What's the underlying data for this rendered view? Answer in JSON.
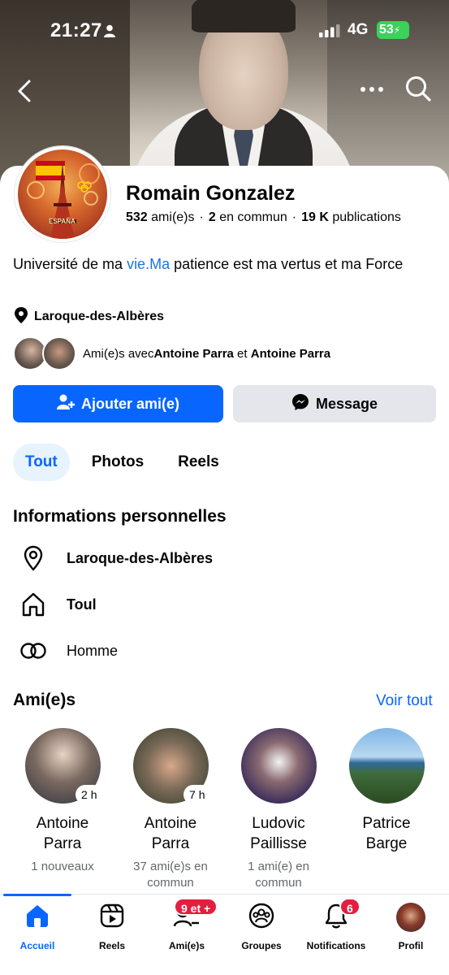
{
  "status_bar": {
    "time": "21:27",
    "network": "4G",
    "battery": "53"
  },
  "profile": {
    "name": "Romain Gonzalez",
    "stats": {
      "friends_count": "532",
      "friends_label": "ami(e)s",
      "mutual_count": "2",
      "mutual_label": "en commun",
      "posts_count": "19 K",
      "posts_label": "publications"
    },
    "bio": {
      "prefix": "Université de ma ",
      "link": "vie.Ma",
      "suffix": " patience est ma vertus et ma Force"
    },
    "location": "Laroque-des-Albères",
    "mutual": {
      "prefix": "Ami(e)s avec ",
      "name1": "Antoine Parra",
      "joiner": " et ",
      "name2": "Antoine Parra"
    },
    "avatar_text": "ESPAÑA"
  },
  "actions": {
    "add_friend": "Ajouter ami(e)",
    "message": "Message"
  },
  "tabs": [
    {
      "label": "Tout",
      "active": true
    },
    {
      "label": "Photos"
    },
    {
      "label": "Reels"
    }
  ],
  "personal_info": {
    "title": "Informations personnelles",
    "items": [
      {
        "icon": "location-pin-icon",
        "text": "Laroque-des-Albères"
      },
      {
        "icon": "home-icon",
        "text": "Toul"
      },
      {
        "icon": "gender-icon",
        "text": "Homme"
      }
    ]
  },
  "friends_section": {
    "title": "Ami(e)s",
    "see_all": "Voir tout",
    "friends": [
      {
        "first": "Antoine",
        "last": "Parra",
        "sub": "1 nouveaux",
        "badge": "2 h"
      },
      {
        "first": "Antoine",
        "last": "Parra",
        "sub": "37 ami(e)s en commun",
        "badge": "7 h"
      },
      {
        "first": "Ludovic",
        "last": "Paillisse",
        "sub": "1 ami(e) en commun"
      },
      {
        "first": "Patrice",
        "last": "Barge",
        "sub": ""
      }
    ]
  },
  "bottom_nav": [
    {
      "label": "Accueil",
      "icon": "home-icon",
      "active": true
    },
    {
      "label": "Reels",
      "icon": "reels-icon"
    },
    {
      "label": "Ami(e)s",
      "icon": "friends-icon",
      "badge": "9 et +"
    },
    {
      "label": "Groupes",
      "icon": "groups-icon"
    },
    {
      "label": "Notifications",
      "icon": "bell-icon",
      "badge": "6"
    },
    {
      "label": "Profil",
      "icon": "profile-avatar"
    }
  ],
  "colors": {
    "accent": "#0866ff",
    "link": "#1b74e4",
    "secondary_button": "#e4e6eb",
    "badge_red": "#e41e3f",
    "battery_green": "#3bd15a"
  }
}
